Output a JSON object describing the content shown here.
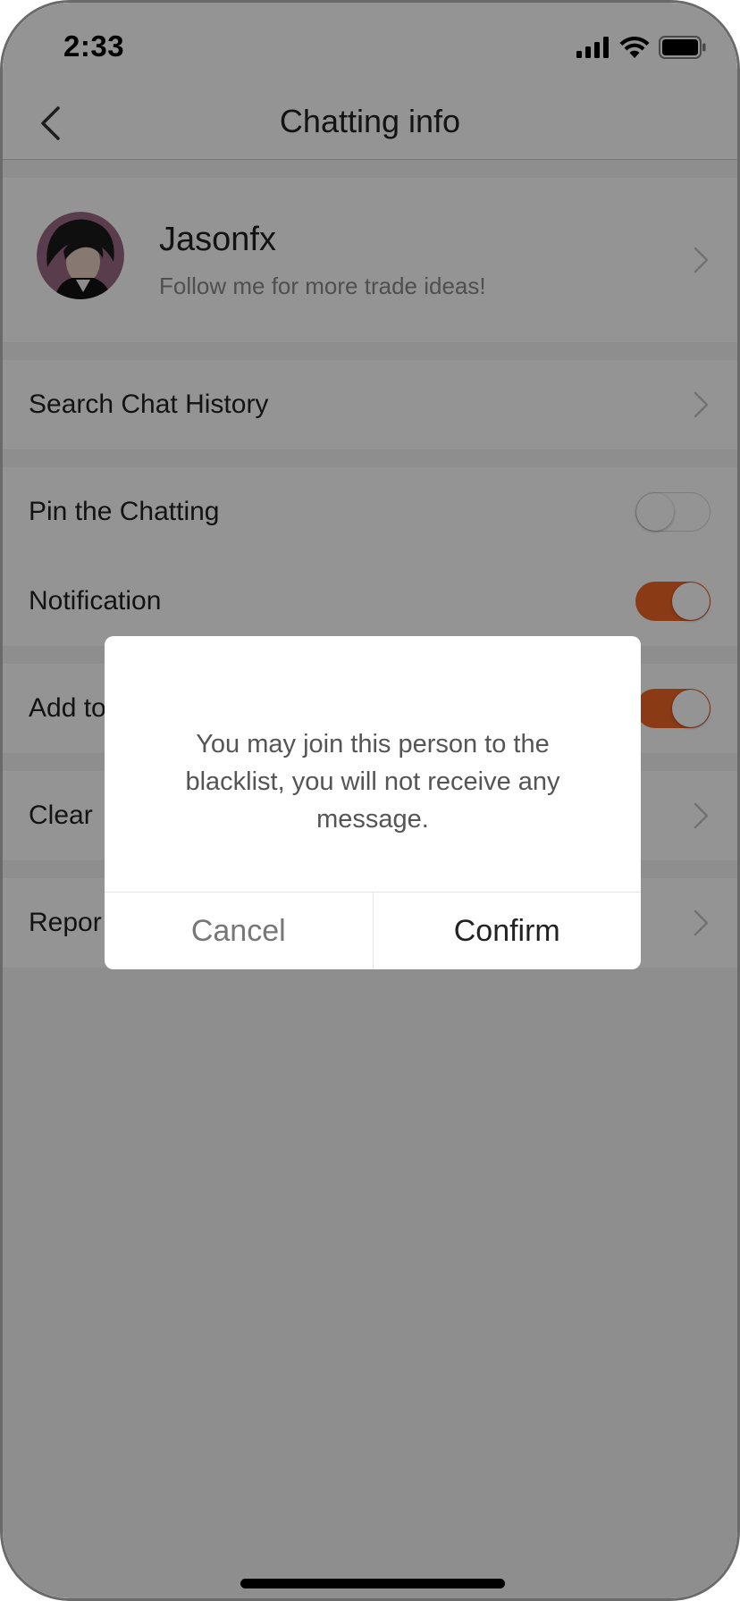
{
  "status_bar": {
    "time": "2:33",
    "icons": [
      "signal-icon",
      "wifi-icon",
      "battery-icon"
    ]
  },
  "nav": {
    "title": "Chatting info",
    "back_icon": "chevron-left-icon"
  },
  "profile": {
    "name": "Jasonfx",
    "bio": "Follow me for more trade ideas!"
  },
  "rows": {
    "search_history": "Search Chat History",
    "pin_chatting": "Pin the Chatting",
    "notification": "Notification",
    "add_to_blacklist": "Add to",
    "clear": "Clear",
    "report": "Repor"
  },
  "toggles": {
    "pin_chatting": false,
    "notification": true,
    "add_to_blacklist": true
  },
  "dialog": {
    "message": "You may join this person to the blacklist, you will not receive any message.",
    "cancel_label": "Cancel",
    "confirm_label": "Confirm"
  },
  "colors": {
    "accent": "#EE6424",
    "overlay": "rgba(0,0,0,0.42)",
    "background": "#F4F4F4"
  }
}
